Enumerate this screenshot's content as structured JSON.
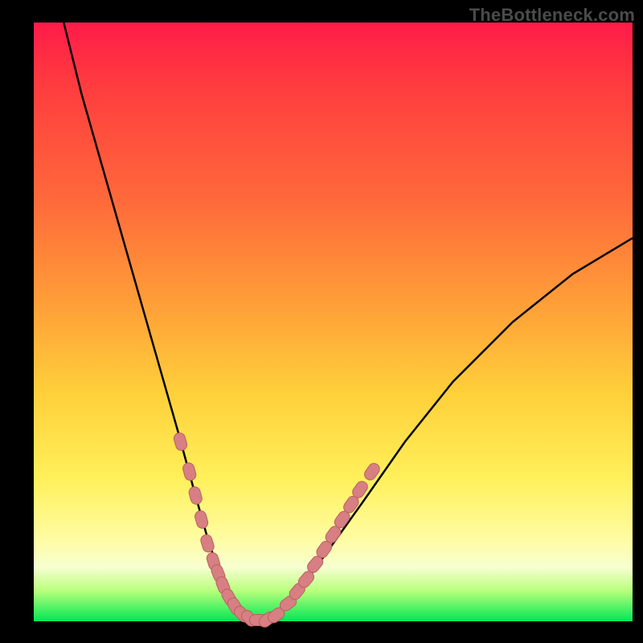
{
  "watermark": "TheBottleneck.com",
  "colors": {
    "background": "#000000",
    "gradient_top": "#ff1b49",
    "gradient_mid1": "#ff6a3a",
    "gradient_mid2": "#ffd03a",
    "gradient_mid3": "#fffca0",
    "gradient_bottom": "#00e756",
    "curve": "#000000",
    "marker_fill": "#d77f82",
    "marker_stroke": "#bb5f62"
  },
  "chart_data": {
    "type": "line",
    "title": "",
    "xlabel": "",
    "ylabel": "",
    "xlim": [
      0,
      100
    ],
    "ylim": [
      0,
      100
    ],
    "series": [
      {
        "name": "bottleneck-curve",
        "x": [
          5,
          8,
          12,
          16,
          20,
          24,
          27,
          29,
          31,
          33,
          35,
          37,
          40,
          45,
          50,
          55,
          62,
          70,
          80,
          90,
          100
        ],
        "y": [
          100,
          88,
          74,
          60,
          46,
          32,
          21,
          14,
          8,
          4,
          1,
          0,
          1,
          6,
          13,
          20,
          30,
          40,
          50,
          58,
          64
        ]
      }
    ],
    "markers": [
      {
        "x": 24.5,
        "y": 30
      },
      {
        "x": 26.0,
        "y": 25
      },
      {
        "x": 27.0,
        "y": 21
      },
      {
        "x": 28.0,
        "y": 17
      },
      {
        "x": 29.0,
        "y": 13
      },
      {
        "x": 30.0,
        "y": 10
      },
      {
        "x": 30.8,
        "y": 8
      },
      {
        "x": 31.6,
        "y": 6
      },
      {
        "x": 32.6,
        "y": 4
      },
      {
        "x": 33.6,
        "y": 2.5
      },
      {
        "x": 34.8,
        "y": 1.2
      },
      {
        "x": 36.0,
        "y": 0.5
      },
      {
        "x": 37.5,
        "y": 0.2
      },
      {
        "x": 39.0,
        "y": 0.3
      },
      {
        "x": 40.5,
        "y": 1.0
      },
      {
        "x": 42.5,
        "y": 3.0
      },
      {
        "x": 44.0,
        "y": 5.0
      },
      {
        "x": 45.5,
        "y": 7.0
      },
      {
        "x": 47.0,
        "y": 9.5
      },
      {
        "x": 48.5,
        "y": 12.0
      },
      {
        "x": 50.0,
        "y": 14.5
      },
      {
        "x": 51.5,
        "y": 17.0
      },
      {
        "x": 53.0,
        "y": 19.5
      },
      {
        "x": 54.5,
        "y": 22.0
      },
      {
        "x": 56.5,
        "y": 25.0
      }
    ],
    "annotations": []
  }
}
